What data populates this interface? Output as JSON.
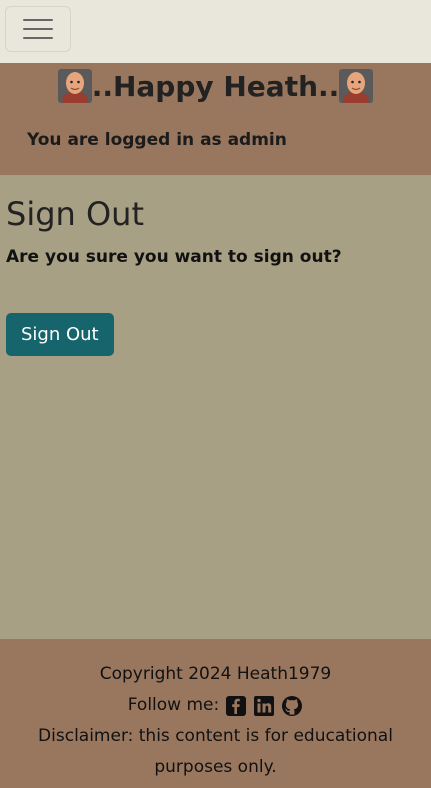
{
  "navbar": {
    "toggle_icon": "hamburger-menu-icon"
  },
  "header": {
    "brand_text": "..Happy Heath..",
    "avatar_icon": "avatar-icon",
    "logged_in_text": "You are logged in as admin"
  },
  "main": {
    "title": "Sign Out",
    "question": "Are you sure you want to sign out?",
    "button_label": "Sign Out",
    "button_color": "#16646c"
  },
  "footer": {
    "copyright": "Copyright 2024 Heath1979",
    "follow_label": "Follow me:",
    "social_icons": [
      "facebook-icon",
      "linkedin-icon",
      "github-icon"
    ],
    "disclaimer": "Disclaimer: this content is for educational purposes only."
  },
  "colors": {
    "navbar_bg": "#e9e6dc",
    "header_bg": "#99775e",
    "main_bg": "#a8a084"
  }
}
